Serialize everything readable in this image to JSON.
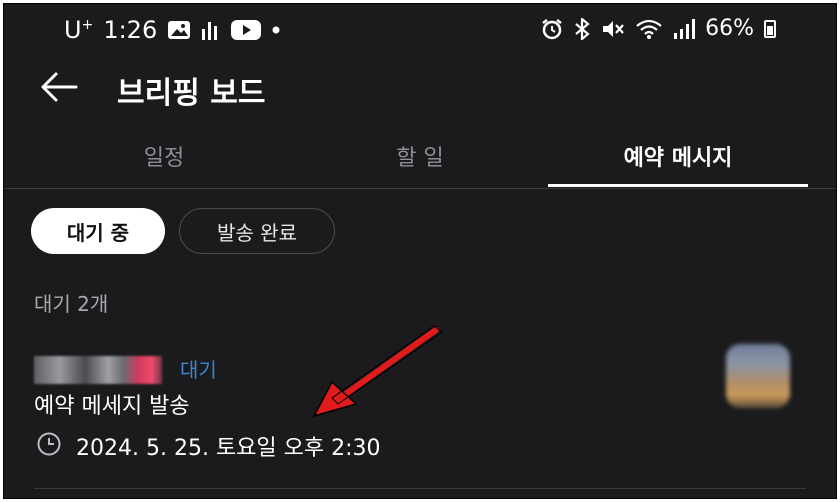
{
  "status_bar": {
    "carrier": "U",
    "carrier_sup": "+",
    "time": "1:26",
    "battery": "66%"
  },
  "header": {
    "title": "브리핑 보드"
  },
  "tabs": [
    {
      "label": "일정",
      "active": false
    },
    {
      "label": "할 일",
      "active": false
    },
    {
      "label": "예약 메시지",
      "active": true
    }
  ],
  "filters": [
    {
      "label": "대기 중",
      "active": true
    },
    {
      "label": "발송 완료",
      "active": false
    }
  ],
  "list": {
    "count_label": "대기 2개",
    "items": [
      {
        "status_badge": "대기",
        "title": "예약 메세지 발송",
        "datetime": "2024. 5. 25. 토요일 오후 2:30"
      }
    ]
  },
  "colors": {
    "background": "#1b1b1d",
    "badge_blue": "#3a86d6",
    "annotation_red": "#e01b1b"
  },
  "icons": [
    "back-arrow-icon",
    "clock-icon",
    "gallery-icon",
    "signal-bars-icon",
    "youtube-icon",
    "alarm-icon",
    "bluetooth-icon",
    "mute-icon",
    "wifi-icon",
    "battery-icon"
  ]
}
